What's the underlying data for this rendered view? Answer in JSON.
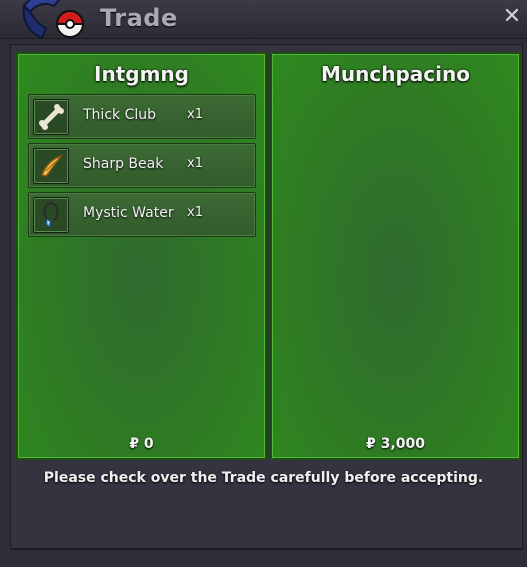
{
  "window": {
    "title": "Trade",
    "close_icon": "close-icon"
  },
  "left_panel": {
    "player": "Intgmng",
    "items": [
      {
        "name": "Thick Club",
        "qty": "x1",
        "icon": "bone-icon"
      },
      {
        "name": "Sharp Beak",
        "qty": "x1",
        "icon": "beak-icon"
      },
      {
        "name": "Mystic Water",
        "qty": "x1",
        "icon": "water-pendant-icon"
      }
    ],
    "money": "₽ 0"
  },
  "right_panel": {
    "player": "Munchpacino",
    "items": [],
    "money": "₽ 3,000"
  },
  "notice": "Please check over the Trade carefully before accepting."
}
